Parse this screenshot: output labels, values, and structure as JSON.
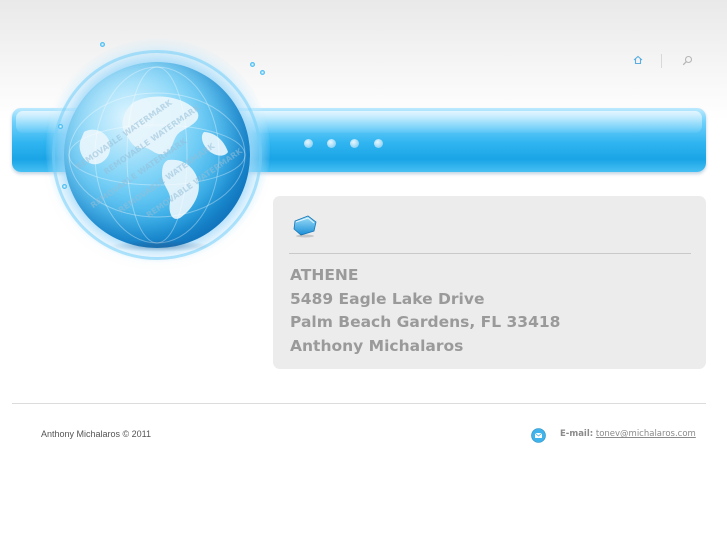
{
  "header": {
    "home_icon": "home-icon",
    "search_icon": "search-icon"
  },
  "globe": {
    "watermark_text": "REMOVABLE WATERMARK"
  },
  "contact_card": {
    "icon": "contact-card-icon",
    "lines": [
      "ATHENE",
      "5489 Eagle Lake Drive",
      "Palm Beach Gardens, FL 33418",
      "Anthony Michalaros"
    ]
  },
  "footer": {
    "copyright": "Anthony Michalaros © 2011",
    "email_label": "E-mail:",
    "email_address": "tonev@michalaros.com",
    "mail_icon": "mail-icon"
  },
  "colors": {
    "accent": "#2fb4f0",
    "card_background": "#ececec",
    "address_text": "#9a9a9a"
  }
}
